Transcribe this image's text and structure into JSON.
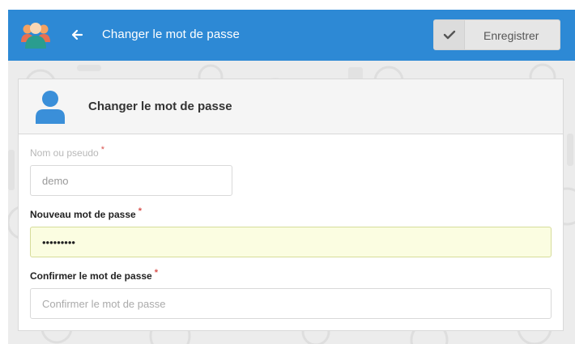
{
  "header": {
    "title": "Changer le mot de passe",
    "save_label": "Enregistrer",
    "brand_color": "#2d89d5"
  },
  "icons": {
    "logo": "users-group-icon",
    "back": "arrow-left-icon",
    "save": "check-icon",
    "user": "user-icon"
  },
  "card": {
    "title": "Changer le mot de passe"
  },
  "form": {
    "required_mark": "*",
    "username": {
      "label": "Nom ou pseudo",
      "value": "demo",
      "disabled": true
    },
    "new_password": {
      "label": "Nouveau mot de passe",
      "value": "•••••••••"
    },
    "confirm_password": {
      "label": "Confirmer le mot de passe",
      "placeholder": "Confirmer le mot de passe",
      "value": ""
    }
  }
}
